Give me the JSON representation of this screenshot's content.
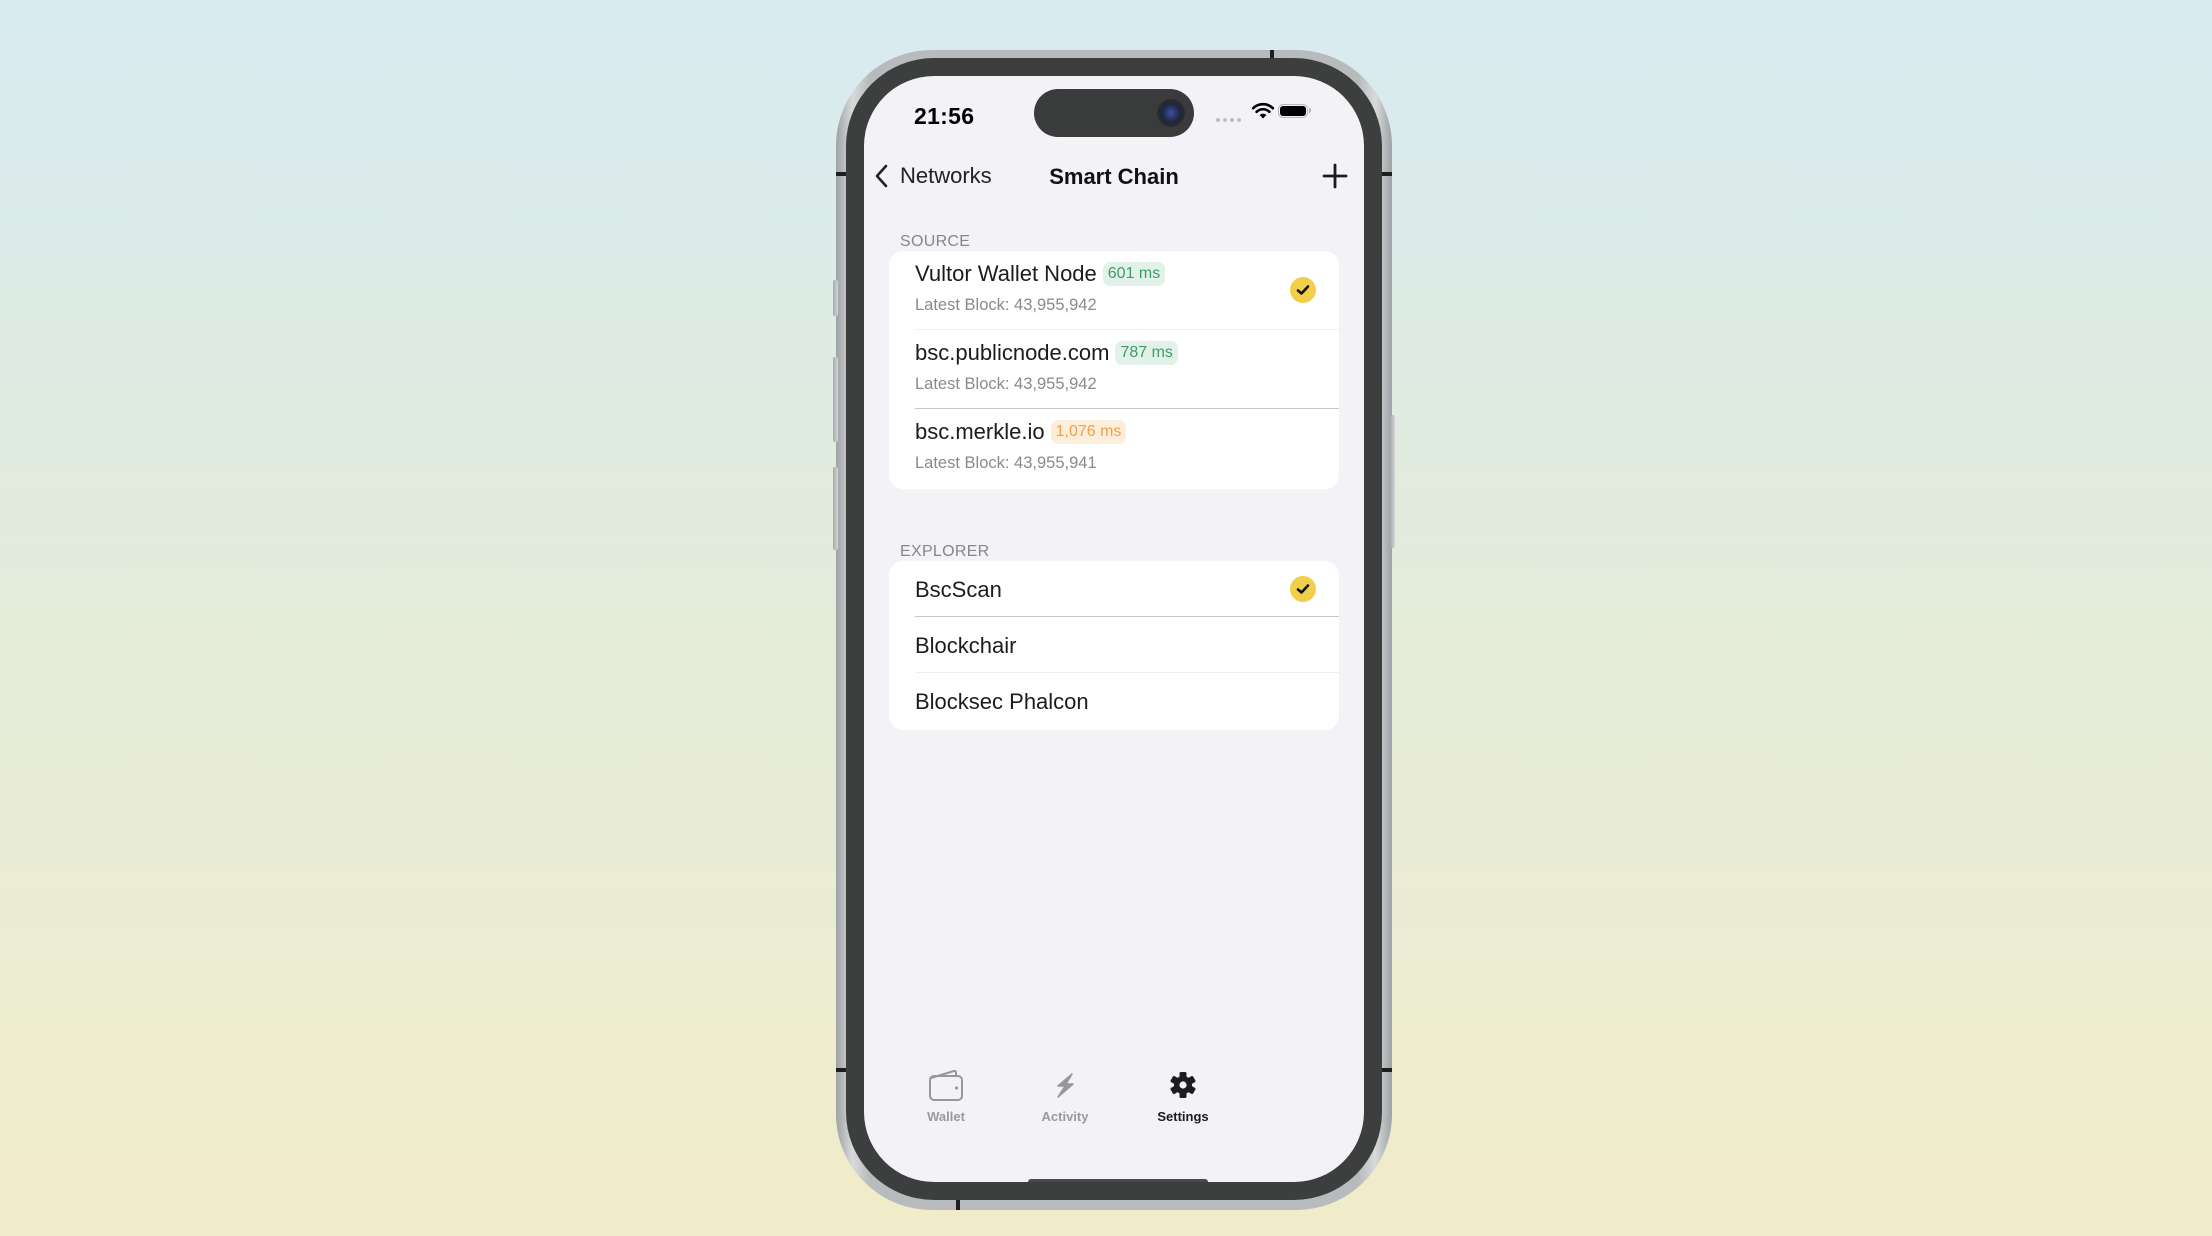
{
  "status_bar": {
    "time": "21:56",
    "icons": [
      "signal-dots-icon",
      "wifi-icon",
      "battery-icon"
    ]
  },
  "nav": {
    "back_label": "Networks",
    "title": "Smart Chain",
    "add_icon": "plus-icon"
  },
  "source": {
    "header": "SOURCE",
    "items": [
      {
        "name": "Vultor Wallet Node",
        "latency": "601 ms",
        "latency_status": "good",
        "latest_block_label": "Latest Block: 43,955,942",
        "selected": true
      },
      {
        "name": "bsc.publicnode.com",
        "latency": "787 ms",
        "latency_status": "good",
        "latest_block_label": "Latest Block: 43,955,942",
        "selected": false
      },
      {
        "name": "bsc.merkle.io",
        "latency": "1,076 ms",
        "latency_status": "slow",
        "latest_block_label": "Latest Block: 43,955,941",
        "selected": false
      }
    ]
  },
  "explorer": {
    "header": "EXPLORER",
    "items": [
      {
        "name": "BscScan",
        "selected": true
      },
      {
        "name": "Blockchair",
        "selected": false
      },
      {
        "name": "Blocksec Phalcon",
        "selected": false
      }
    ]
  },
  "tabbar": {
    "tabs": [
      {
        "label": "Wallet",
        "icon": "wallet-icon",
        "active": false
      },
      {
        "label": "Activity",
        "icon": "lightning-icon",
        "active": false
      },
      {
        "label": "Settings",
        "icon": "gear-icon",
        "active": true
      }
    ]
  },
  "colors": {
    "good_text": "#3f9b6b",
    "good_bg": "#e2f2e9",
    "slow_text": "#f0a04a",
    "slow_bg": "#fdeedb",
    "check_fill": "#f2cf4a",
    "tab_active": "#1c1c1e",
    "tab_inactive": "#9a9a9e"
  }
}
